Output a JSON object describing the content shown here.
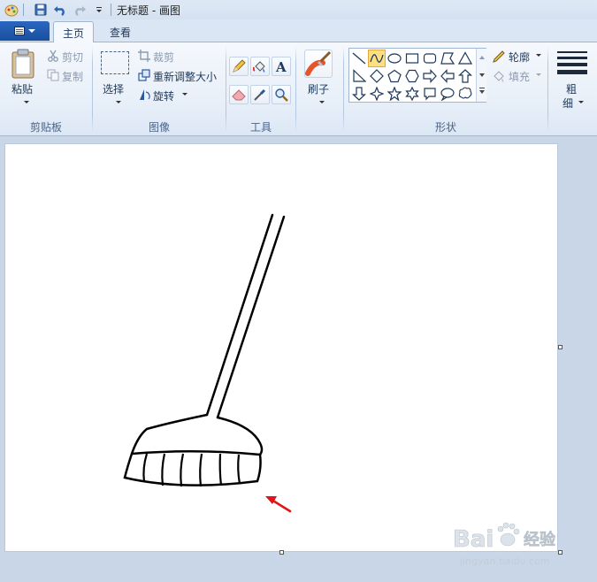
{
  "window": {
    "title": "无标题 - 画图"
  },
  "tabs": [
    {
      "label": "主页",
      "active": true
    },
    {
      "label": "查看",
      "active": false
    }
  ],
  "ribbon": {
    "clipboard": {
      "group_label": "剪贴板",
      "paste": "粘贴",
      "cut": "剪切",
      "copy": "复制"
    },
    "image": {
      "group_label": "图像",
      "select": "选择",
      "crop": "裁剪",
      "resize": "重新调整大小",
      "rotate": "旋转"
    },
    "tools": {
      "group_label": "工具"
    },
    "brushes": {
      "label": "刷子"
    },
    "shapes": {
      "group_label": "形状",
      "outline": "轮廓",
      "fill": "填充"
    },
    "size": {
      "line1": "粗",
      "line2": "细"
    }
  },
  "watermark": {
    "brand": "Bai",
    "suffix": "经验",
    "url": "jingyan.baidu.com"
  },
  "colors": {
    "accent_blue": "#1a4f9f",
    "selected_shape": "#fddf82",
    "arrow_red": "#e0141b",
    "canvas": "#ffffff"
  },
  "icons": [
    "paint-app-icon",
    "save-icon",
    "undo-icon",
    "redo-icon",
    "customize-qat-icon",
    "paste-icon",
    "cut-icon",
    "copy-icon",
    "select-icon",
    "crop-icon",
    "resize-icon",
    "rotate-icon",
    "pencil-icon",
    "fill-bucket-icon",
    "text-icon",
    "eraser-icon",
    "color-picker-icon",
    "magnifier-icon",
    "brush-icon",
    "outline-icon",
    "fill-icon",
    "size-icon"
  ]
}
